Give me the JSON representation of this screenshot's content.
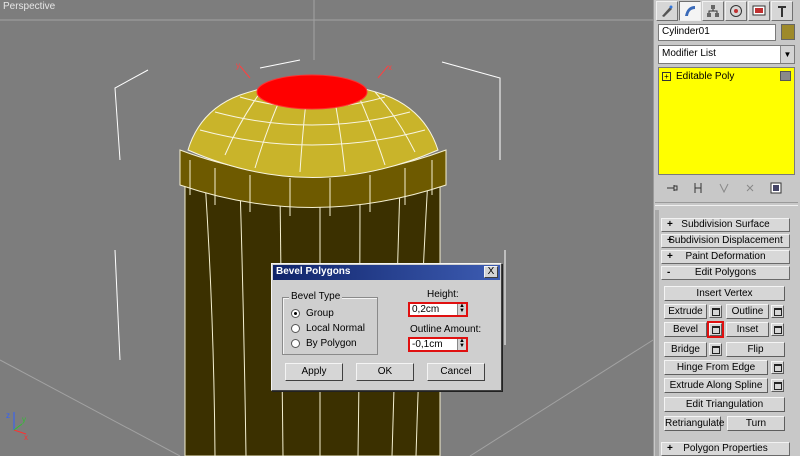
{
  "viewport": {
    "label": "Perspective",
    "object_color": "#c9b42a",
    "selected_face_color": "#ff0000",
    "background": "#7d7d7d",
    "axis_labels": {
      "x": "x",
      "y": "y",
      "z": "z"
    }
  },
  "command_panel": {
    "tabs": [
      "create-icon",
      "modify-icon",
      "hierarchy-icon",
      "motion-icon",
      "display-icon",
      "utilities-icon"
    ],
    "object_name": "Cylinder01",
    "object_color": "#9e8a2a",
    "modifier_list": "Modifier List",
    "stack": {
      "item": "Editable Poly",
      "highlight": "#ffff00"
    },
    "rollouts": {
      "subdivision_surface": {
        "sign": "+",
        "label": "Subdivision Surface"
      },
      "subdivision_displacement": {
        "sign": "+",
        "label": "Subdivision Displacement"
      },
      "paint_deformation": {
        "sign": "+",
        "label": "Paint Deformation"
      },
      "edit_polygons": {
        "sign": "-",
        "label": "Edit Polygons"
      },
      "polygon_properties": {
        "sign": "+",
        "label": "Polygon Properties"
      }
    },
    "buttons": {
      "insert_vertex": "Insert Vertex",
      "extrude": "Extrude",
      "outline": "Outline",
      "bevel": "Bevel",
      "inset": "Inset",
      "bridge": "Bridge",
      "flip": "Flip",
      "hinge_from_edge": "Hinge From Edge",
      "extrude_along_spline": "Extrude Along Spline",
      "edit_triangulation": "Edit Triangulation",
      "retriangulate": "Retriangulate",
      "turn": "Turn"
    }
  },
  "dialog": {
    "title": "Bevel Polygons",
    "close": "X",
    "bevel_type_title": "Bevel Type",
    "options": [
      "Group",
      "Local Normal",
      "By Polygon"
    ],
    "selected_option": "Group",
    "height_label": "Height:",
    "height_value": "0,2cm",
    "outline_label": "Outline Amount:",
    "outline_value": "-0,1cm",
    "apply": "Apply",
    "ok": "OK",
    "cancel": "Cancel",
    "highlight_color": "#e01010"
  }
}
